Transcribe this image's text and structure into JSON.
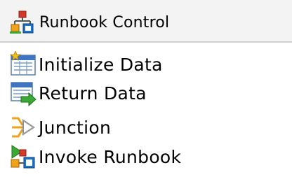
{
  "header": {
    "label": "Runbook Control",
    "icon": "runbook-control-icon"
  },
  "items": [
    {
      "label": "Initialize Data",
      "icon": "initialize-data-icon"
    },
    {
      "label": "Return Data",
      "icon": "return-data-icon"
    },
    {
      "label": "Junction",
      "icon": "junction-icon"
    },
    {
      "label": "Invoke Runbook",
      "icon": "invoke-runbook-icon"
    }
  ],
  "colors": {
    "header_bg": "#f3f3f3",
    "divider": "#cfcfcf",
    "background": "#ffffff",
    "accent_blue": "#1e73c9",
    "accent_green": "#3aa935",
    "accent_orange": "#f0a21a",
    "accent_red": "#d33a2b"
  }
}
